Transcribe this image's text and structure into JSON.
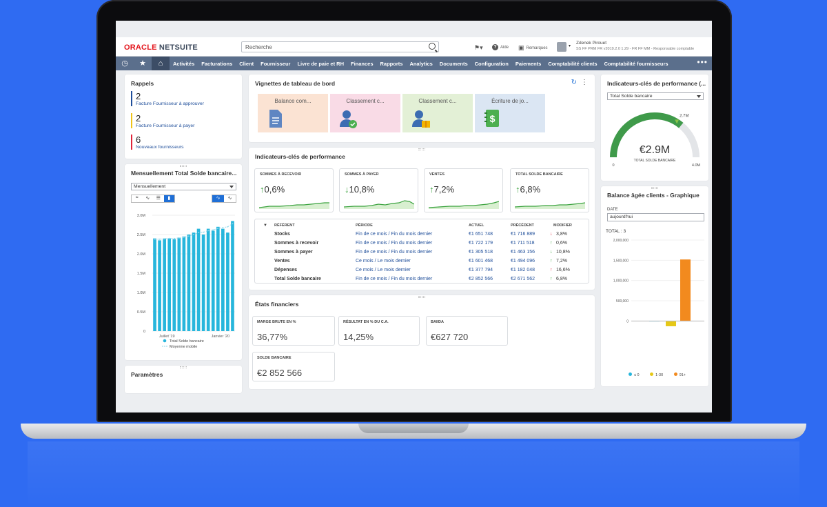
{
  "header": {
    "logo_oracle": "ORACLE",
    "logo_netsuite": "NETSUITE",
    "search_placeholder": "Recherche",
    "help": "Aide",
    "feedback": "Remarques",
    "user_name": "Zdenek Pirouet",
    "user_role": "SS FF PRM FR v2019.2.0 1.29 - FR FF MM - Responsable comptable"
  },
  "nav": {
    "items": [
      "Activités",
      "Facturations",
      "Client",
      "Fournisseur",
      "Livre de paie et RH",
      "Finances",
      "Rapports",
      "Analytics",
      "Documents",
      "Configuration",
      "Paiements",
      "Comptabilité clients",
      "Comptabilité fournisseurs"
    ],
    "more": "•••"
  },
  "reminders": {
    "title": "Rappels",
    "items": [
      {
        "count": "2",
        "label": "Facture Fournisseur à approuver",
        "color": "#1f4e9a"
      },
      {
        "count": "2",
        "label": "Facture Fournisseur à payer",
        "color": "#f0c419"
      },
      {
        "count": "6",
        "label": "Nouveaux fournisseurs",
        "color": "#e0253a"
      }
    ]
  },
  "monthly": {
    "title": "Mensuellement Total Solde bancaire...",
    "select": "Mensuellement",
    "legend_bars": "Total Solde bancaire",
    "legend_line": "Moyenne mobile"
  },
  "settings": {
    "title": "Paramètres"
  },
  "tiles": {
    "title": "Vignettes de tableau de bord",
    "items": [
      {
        "label": "Balance com...",
        "bg": "#fbe3d3"
      },
      {
        "label": "Classement c...",
        "bg": "#f9dbe6"
      },
      {
        "label": "Classement c...",
        "bg": "#e3f0d6"
      },
      {
        "label": "Écriture de jo...",
        "bg": "#dbe6f3"
      }
    ]
  },
  "kpi": {
    "title": "Indicateurs-clés de performance",
    "cards": [
      {
        "label": "Sommes à recevoir",
        "arrow": "↑",
        "value": "0,6%"
      },
      {
        "label": "Sommes à payer",
        "arrow": "↓",
        "value": "10,8%"
      },
      {
        "label": "Ventes",
        "arrow": "↑",
        "value": "7,2%"
      },
      {
        "label": "Total Solde bancaire",
        "arrow": "↑",
        "value": "6,8%"
      }
    ],
    "table": {
      "headers": [
        "RÉFÉRENT",
        "PÉRIODE",
        "ACTUEL",
        "PRÉCÉDENT",
        "MODIFIER"
      ],
      "rows": [
        {
          "ref": "Stocks",
          "period": "Fin de ce mois / Fin du mois dernier",
          "current": "€1 651 748",
          "previous": "€1 716 889",
          "arrow": "↓",
          "arrow_color": "#e0253a",
          "change": "3,8%"
        },
        {
          "ref": "Sommes à recevoir",
          "period": "Fin de ce mois / Fin du mois dernier",
          "current": "€1 722 179",
          "previous": "€1 711 518",
          "arrow": "↑",
          "arrow_color": "#36a23a",
          "change": "0,6%"
        },
        {
          "ref": "Sommes à payer",
          "period": "Fin de ce mois / Fin du mois dernier",
          "current": "€1 305 518",
          "previous": "€1 463 156",
          "arrow": "↓",
          "arrow_color": "#36a23a",
          "change": "10,8%"
        },
        {
          "ref": "Ventes",
          "period": "Ce mois / Le mois dernier",
          "current": "€1 601 468",
          "previous": "€1 494 096",
          "arrow": "↑",
          "arrow_color": "#36a23a",
          "change": "7,2%"
        },
        {
          "ref": "Dépenses",
          "period": "Ce mois / Le mois dernier",
          "current": "€1 377 794",
          "previous": "€1 182 048",
          "arrow": "↑",
          "arrow_color": "#e0253a",
          "change": "16,6%"
        },
        {
          "ref": "Total Solde bancaire",
          "period": "Fin de ce mois / Fin du mois dernier",
          "current": "€2 852 566",
          "previous": "€2 671 562",
          "arrow": "↑",
          "arrow_color": "#36a23a",
          "change": "6,8%"
        }
      ]
    }
  },
  "financial": {
    "title": "États financiers",
    "cards": [
      {
        "label": "MARGE BRUTE EN %",
        "value": "36,77%"
      },
      {
        "label": "RÉSULTAT EN % DU C.A.",
        "value": "14,25%"
      },
      {
        "label": "BAIIDA",
        "value": "€627 720"
      },
      {
        "label": "SOLDE BANCAIRE",
        "value": "€2 852 566"
      }
    ]
  },
  "gauge": {
    "title": "Indicateurs-clés de performance (...",
    "select": "Total Solde bancaire",
    "value": "€2.9M",
    "caption": "TOTAL SOLDE BANCAIRE",
    "marker": "2.7M",
    "min": "0",
    "max": "4.0M",
    "fraction": 0.72
  },
  "aging": {
    "title": "Balance âgée clients - Graphique",
    "date_label": "DATE",
    "date_value": "aujourd'hui",
    "total": "TOTAL : 3",
    "legend": [
      {
        "label": "≤ 0",
        "color": "#27b6dc"
      },
      {
        "label": "1-30",
        "color": "#e6c817"
      },
      {
        "label": "91+",
        "color": "#f28a1e"
      }
    ]
  },
  "chart_data": [
    {
      "type": "bar",
      "title": "Mensuellement Total Solde bancaire...",
      "categories": [
        "Juillet '19",
        "",
        "",
        "",
        "",
        "",
        "",
        "",
        "",
        "",
        "",
        "",
        "",
        "",
        "",
        "Janvier '20",
        ""
      ],
      "x_tick_labels": [
        "Juillet '19",
        "Janvier '20"
      ],
      "y_tick_labels": [
        "0",
        "0.5M",
        "1.0M",
        "1.5M",
        "2.0M",
        "2.5M",
        "3.0M"
      ],
      "ylim": [
        0,
        3.0
      ],
      "series": [
        {
          "name": "Total Solde bancaire",
          "values": [
            2.4,
            2.35,
            2.4,
            2.4,
            2.38,
            2.42,
            2.45,
            2.5,
            2.55,
            2.65,
            2.5,
            2.65,
            2.6,
            2.7,
            2.65,
            2.55,
            2.85
          ]
        },
        {
          "name": "Moyenne mobile",
          "values": [
            2.38,
            2.38,
            2.39,
            2.4,
            2.4,
            2.41,
            2.43,
            2.46,
            2.5,
            2.55,
            2.56,
            2.6,
            2.62,
            2.66,
            2.68,
            2.7,
            2.78
          ]
        }
      ]
    },
    {
      "type": "bar",
      "title": "Balance âgée clients - Graphique",
      "categories": [
        "≤ 0",
        "1-30",
        "91+"
      ],
      "y_tick_labels": [
        "0",
        "500,000",
        "1,000,000",
        "1,500,000",
        "2,000,000"
      ],
      "ylim": [
        -250000,
        2000000
      ],
      "values": [
        5000,
        -130000,
        1520000
      ]
    }
  ]
}
